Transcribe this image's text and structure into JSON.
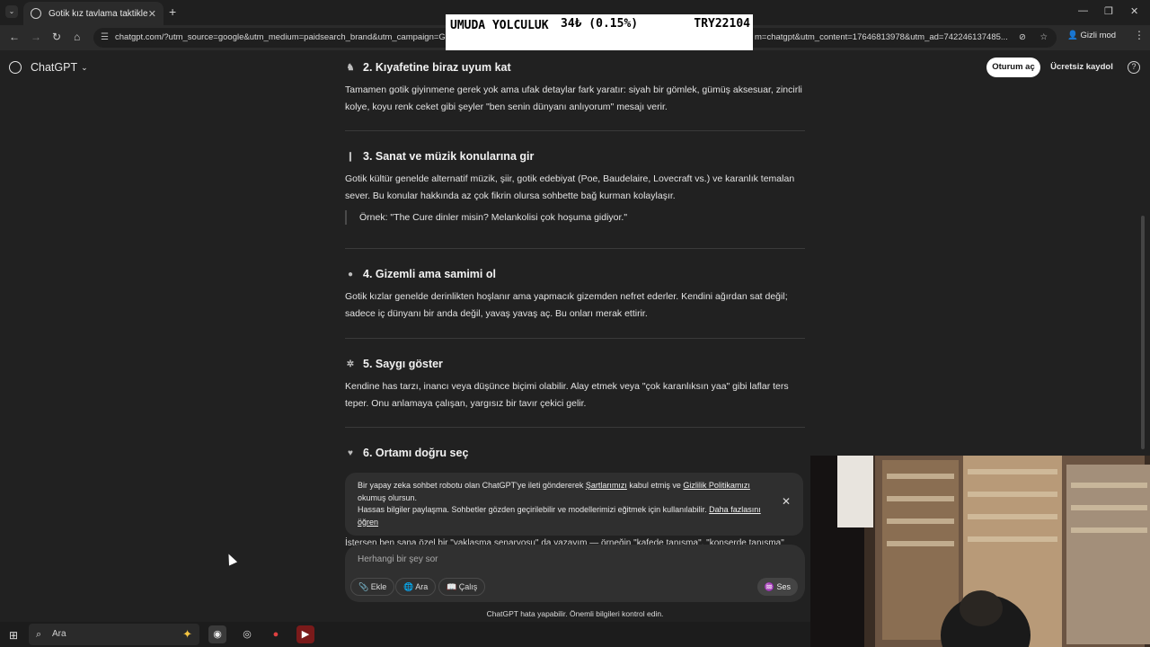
{
  "browser": {
    "tab_title": "Gotik kız tavlama taktikleri",
    "url": "chatgpt.com/?utm_source=google&utm_medium=paidsearch_brand&utm_campaign=G",
    "url_tail": "m=chatgpt&utm_content=17646813978&utm_ad=742246137485...",
    "incognito_label": "Gizli mod"
  },
  "ticker": {
    "line1": "UMUDA YOLCULUK",
    "line2": "34₺ (0.15%)",
    "line3": "TRY22104"
  },
  "header": {
    "brand": "ChatGPT",
    "login": "Oturum aç",
    "signup": "Ücretsiz kaydol",
    "help": "?"
  },
  "sections": [
    {
      "title": "2. Kıyafetine biraz uyum kat",
      "body": "Tamamen gotik giyinmene gerek yok ama ufak detaylar fark yaratır: siyah bir gömlek, gümüş aksesuar, zincirli kolye, koyu renk ceket gibi şeyler \"ben senin dünyanı anlıyorum\" mesajı verir."
    },
    {
      "title": "3. Sanat ve müzik konularına gir",
      "body": "Gotik kültür genelde alternatif müzik, şiir, gotik edebiyat (Poe, Baudelaire, Lovecraft vs.) ve karanlık temalan sever. Bu konular hakkında az çok fikrin olursa sohbette bağ kurman kolaylaşır.",
      "quote": "Örnek: \"The Cure dinler misin? Melankolisi çok hoşuma gidiyor.\""
    },
    {
      "title": "4. Gizemli ama samimi ol",
      "body": "Gotik kızlar genelde derinlikten hoşlanır ama yapmacık gizemden nefret ederler. Kendini ağırdan sat değil; sadece iç dünyanı bir anda değil, yavaş yavaş aç. Bu onları merak ettirir."
    },
    {
      "title": "5. Saygı göster",
      "body": "Kendine has tarzı, inancı veya düşünce biçimi olabilir. Alay etmek veya \"çok karanlıksın yaa\" gibi laflar ters teper. Onu anlamaya çalışan, yargısız bir tavır çekici gelir."
    },
    {
      "title": "6. Ortamı doğru seç"
    }
  ],
  "notice": {
    "text1": "Bir yapay zeka sohbet robotu olan ChatGPT'ye ileti göndererek ",
    "terms": "Şartlarımızı",
    "text2": " kabul etmiş ve ",
    "privacy": "Gizlilik Politikamızı",
    "text3": " okumuş olursun.",
    "text4": "Hassas bilgiler paylaşma. Sohbetler gözden geçirilebilir ve modellerimizi eğitmek için kullanılabilir. ",
    "learn_more": "Daha fazlasını öğren"
  },
  "peek_text": "İstersen ben sana özel bir \"yaklaşma senaryosu\" da yazayım — örneğin \"kafede tanışma\", \"konserde tanışma\"",
  "composer": {
    "placeholder": "Herhangi bir şey sor",
    "attach": "Ekle",
    "search": "Ara",
    "study": "Çalış",
    "voice": "Ses"
  },
  "disclaimer": "ChatGPT hata yapabilir. Önemli bilgileri kontrol edin.",
  "taskbar": {
    "search_label": "Ara"
  }
}
